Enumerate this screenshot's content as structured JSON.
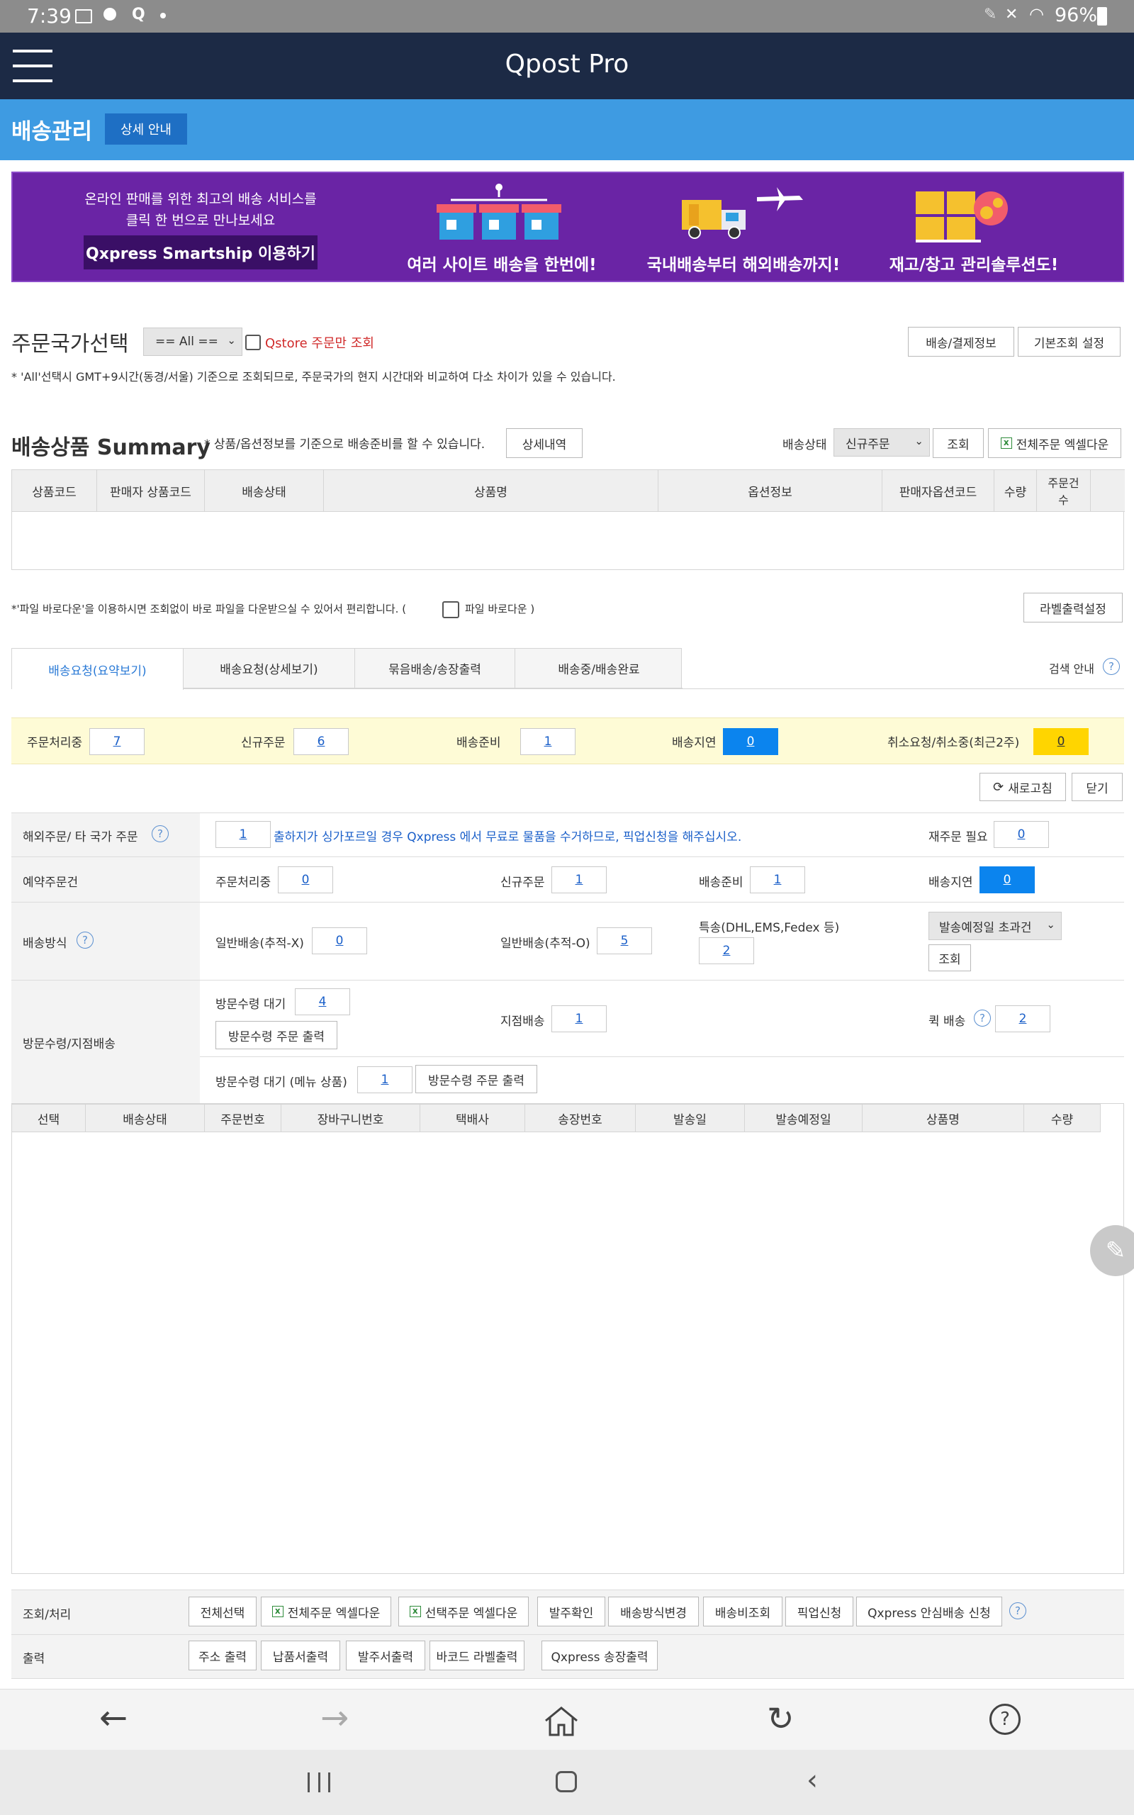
{
  "status_bar": {
    "time": "7:39",
    "battery": "96%"
  },
  "app": {
    "title": "Qpost Pro"
  },
  "header": {
    "title": "배송관리",
    "detail_button": "상세 안내"
  },
  "banner": {
    "intro_line1": "온라인 판매를 위한 최고의 배송 서비스를",
    "intro_line2": "클릭 한 번으로 만나보세요",
    "cta": "Qxpress Smartship 이용하기",
    "feature1": "여러 사이트 배송을 한번에!",
    "feature2": "국내배송부터 해외배송까지!",
    "feature3": "재고/창고 관리솔루션도!"
  },
  "country": {
    "title": "주문국가선택",
    "select_value": "== All ==",
    "qstore_label": "Qstore 주문만 조회",
    "btn_payment": "배송/결제정보",
    "btn_default": "기본조회 설정",
    "note": "* 'All'선택시 GMT+9시간(동경/서울) 기준으로 조회되므로, 주문국가의 현지 시간대와 비교하여 다소 차이가 있을 수 있습니다."
  },
  "summary": {
    "title": "배송상품 Summary",
    "note": "* 상품/옵션정보를 기준으로 배송준비를 할 수 있습니다.",
    "btn_detail": "상세내역",
    "status_label": "배송상태",
    "status_value": "신규주문",
    "btn_search": "조회",
    "btn_excel": "전체주문 엑셀다운",
    "columns": [
      "상품코드",
      "판매자 상품코드",
      "배송상태",
      "상품명",
      "옵션정보",
      "판매자옵션코드",
      "수량",
      "주문건수"
    ]
  },
  "file_note": {
    "text": "*'파일 바로다운'을 이용하시면 조회없이 바로 파일을 다운받으실 수 있어서 편리합니다. (",
    "checkbox_label": "파일 바로다운 )",
    "btn_label_settings": "라벨출력설정"
  },
  "tabs": [
    "배송요청(요약보기)",
    "배송요청(상세보기)",
    "묶음배송/송장출력",
    "배송중/배송완료"
  ],
  "search_guide": "검색 안내",
  "counts": {
    "processing_label": "주문처리중",
    "processing": "7",
    "new_label": "신규주문",
    "new": "6",
    "ready_label": "배송준비",
    "ready": "1",
    "delayed_label": "배송지연",
    "delayed": "0",
    "cancel_label": "취소요청/취소중(최근2주)",
    "cancel": "0"
  },
  "actions": {
    "refresh": "새로고침",
    "close": "닫기"
  },
  "overseas": {
    "label": "해외주문/ 타 국가 주문",
    "count": "1",
    "message": "출하지가 싱가포르일 경우 Qxpress 에서 무료로 물품을 수거하므로, 픽업신청을 해주십시오.",
    "reorder_label": "재주문 필요",
    "reorder": "0"
  },
  "reserved": {
    "label": "예약주문건",
    "processing_label": "주문처리중",
    "processing": "0",
    "new_label": "신규주문",
    "new": "1",
    "ready_label": "배송준비",
    "ready": "1",
    "delayed_label": "배송지연",
    "delayed": "0"
  },
  "shipping_method": {
    "label": "배송방식",
    "normal_x_label": "일반배송(추적-X)",
    "normal_x": "0",
    "normal_o_label": "일반배송(추적-O)",
    "normal_o": "5",
    "special_label": "특송(DHL,EMS,Fedex 등)",
    "special": "2",
    "due_select": "발송예정일 초과건",
    "btn_search": "조회"
  },
  "visit": {
    "label": "방문수령/지점배송",
    "wait_label": "방문수령 대기",
    "wait": "4",
    "btn_print": "방문수령 주문 출력",
    "branch_label": "지점배송",
    "branch": "1",
    "quick_label": "퀵 배송",
    "quick": "2",
    "menu_wait_label": "방문수령 대기 (메뉴 상품)",
    "menu_wait": "1",
    "btn_print2": "방문수령 주문 출력"
  },
  "list_columns": [
    "선택",
    "배송상태",
    "주문번호",
    "장바구니번호",
    "택배사",
    "송장번호",
    "발송일",
    "발송예정일",
    "상품명",
    "수량"
  ],
  "process": {
    "label": "조회/처리",
    "buttons": [
      "전체선택",
      "전체주문 엑셀다운",
      "선택주문 엑셀다운",
      "발주확인",
      "배송방식변경",
      "배송비조회",
      "픽업신청",
      "Qxpress 안심배송 신청"
    ]
  },
  "output": {
    "label": "출력",
    "buttons": [
      "주소 출력",
      "납품서출력",
      "발주서출력",
      "바코드 라벨출력",
      "Qxpress 송장출력"
    ]
  },
  "colors": {
    "navy": "#1c2a45",
    "header_blue": "#3e9be2",
    "banner_purple": "#6a24a5",
    "highlight": "#fefbd6",
    "blue_box": "#0b84ee",
    "yellow_box": "#ffd500"
  }
}
